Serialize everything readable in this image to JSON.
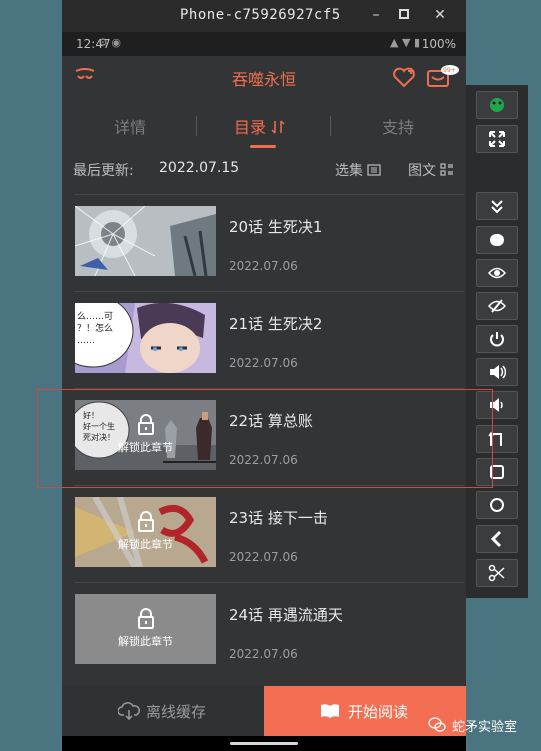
{
  "window": {
    "title": "Phone-c75926927cf5"
  },
  "status_bar": {
    "time": "12:47",
    "battery": "100%"
  },
  "header": {
    "title": "吞噬永恒",
    "badge": "99+"
  },
  "tabs": [
    {
      "label": "详情"
    },
    {
      "label": "目录"
    },
    {
      "label": "支持"
    }
  ],
  "update_row": {
    "label": "最后更新:",
    "date": "2022.07.15",
    "select_label": "选集",
    "view_label": "图文"
  },
  "chapters": [
    {
      "title": "20话  生死决1",
      "date": "2022.07.06",
      "locked": false,
      "bubble": ""
    },
    {
      "title": "21话  生死决2",
      "date": "2022.07.06",
      "locked": false,
      "bubble": "么……可\n？！怎么\n……"
    },
    {
      "title": "22话  算总账",
      "date": "2022.07.06",
      "locked": true,
      "bubble": "好！\n好一个生\n死对决！"
    },
    {
      "title": "23话  接下一击",
      "date": "2022.07.06",
      "locked": true,
      "bubble": ""
    },
    {
      "title": "24话  再遇流通天",
      "date": "2022.07.06",
      "locked": true,
      "bubble": ""
    }
  ],
  "lock_label": "解锁此章节",
  "bottom": {
    "offline_label": "离线缓存",
    "read_label": "开始阅读"
  },
  "watermark": "蛇矛实验室",
  "colors": {
    "accent": "#f06e4c",
    "read_button": "#f36e52",
    "background": "#333436"
  }
}
